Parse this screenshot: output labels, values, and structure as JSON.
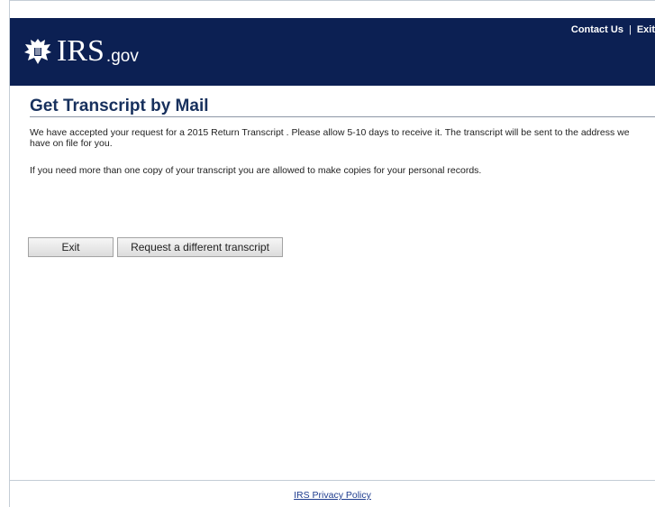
{
  "header": {
    "logo_text": "IRS",
    "logo_suffix": ".gov",
    "links": {
      "contact": "Contact Us",
      "separator": "|",
      "exit": "Exit"
    },
    "colors": {
      "background": "#0c2053",
      "text": "#ffffff"
    }
  },
  "main": {
    "title": "Get Transcript by Mail",
    "paragraph1": "We have accepted your request for a 2015 Return Transcript . Please allow 5-10 days to receive it. The transcript will be sent to the address we have on file for you.",
    "paragraph2": "If you need more than one copy of your transcript you are allowed to make copies for your personal records.",
    "buttons": {
      "exit": "Exit",
      "request_different": "Request a different transcript"
    },
    "colors": {
      "title": "#17305d"
    }
  },
  "footer": {
    "privacy_link": "IRS Privacy Policy",
    "colors": {
      "link": "#1f3d8f"
    }
  },
  "icons": {
    "logo_emblem": "eagle-icon"
  }
}
